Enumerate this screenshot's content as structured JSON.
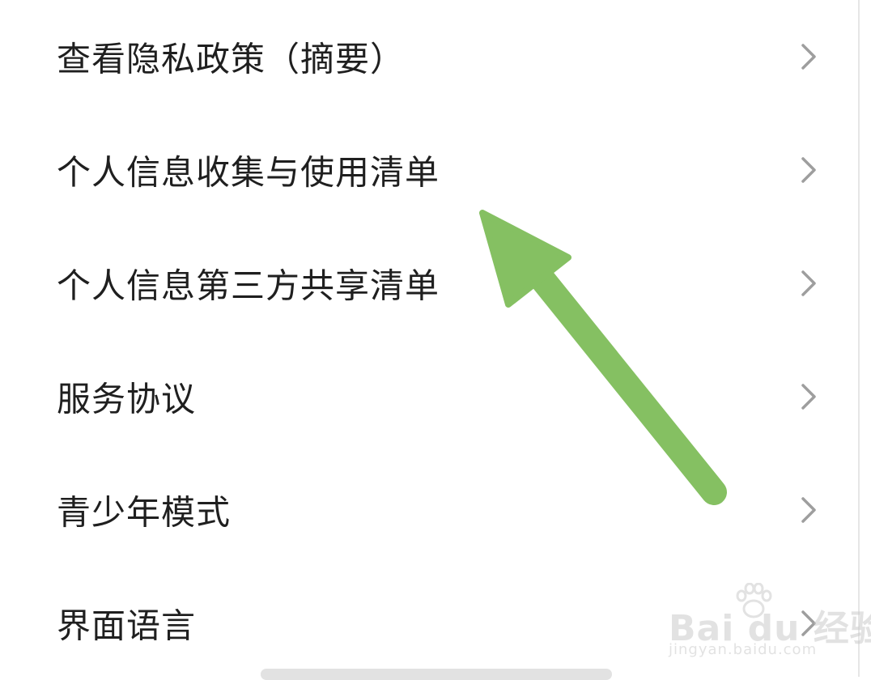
{
  "menu": {
    "items": [
      {
        "label": "查看隐私政策（摘要）",
        "icon": "chevron-right-icon"
      },
      {
        "label": "个人信息收集与使用清单",
        "icon": "chevron-right-icon"
      },
      {
        "label": "个人信息第三方共享清单",
        "icon": "chevron-right-icon"
      },
      {
        "label": "服务协议",
        "icon": "chevron-right-icon"
      },
      {
        "label": "青少年模式",
        "icon": "chevron-right-icon"
      },
      {
        "label": "界面语言",
        "icon": "chevron-right-icon"
      }
    ]
  },
  "annotation": {
    "icon": "pointer-arrow-icon",
    "color": "#85c062"
  },
  "watermark": {
    "brand": "Bai du 经验",
    "site": "jingyan.baidu.com"
  },
  "colors": {
    "text": "#1f1f1f",
    "chevron": "#9e9e9e",
    "background": "#ffffff"
  }
}
